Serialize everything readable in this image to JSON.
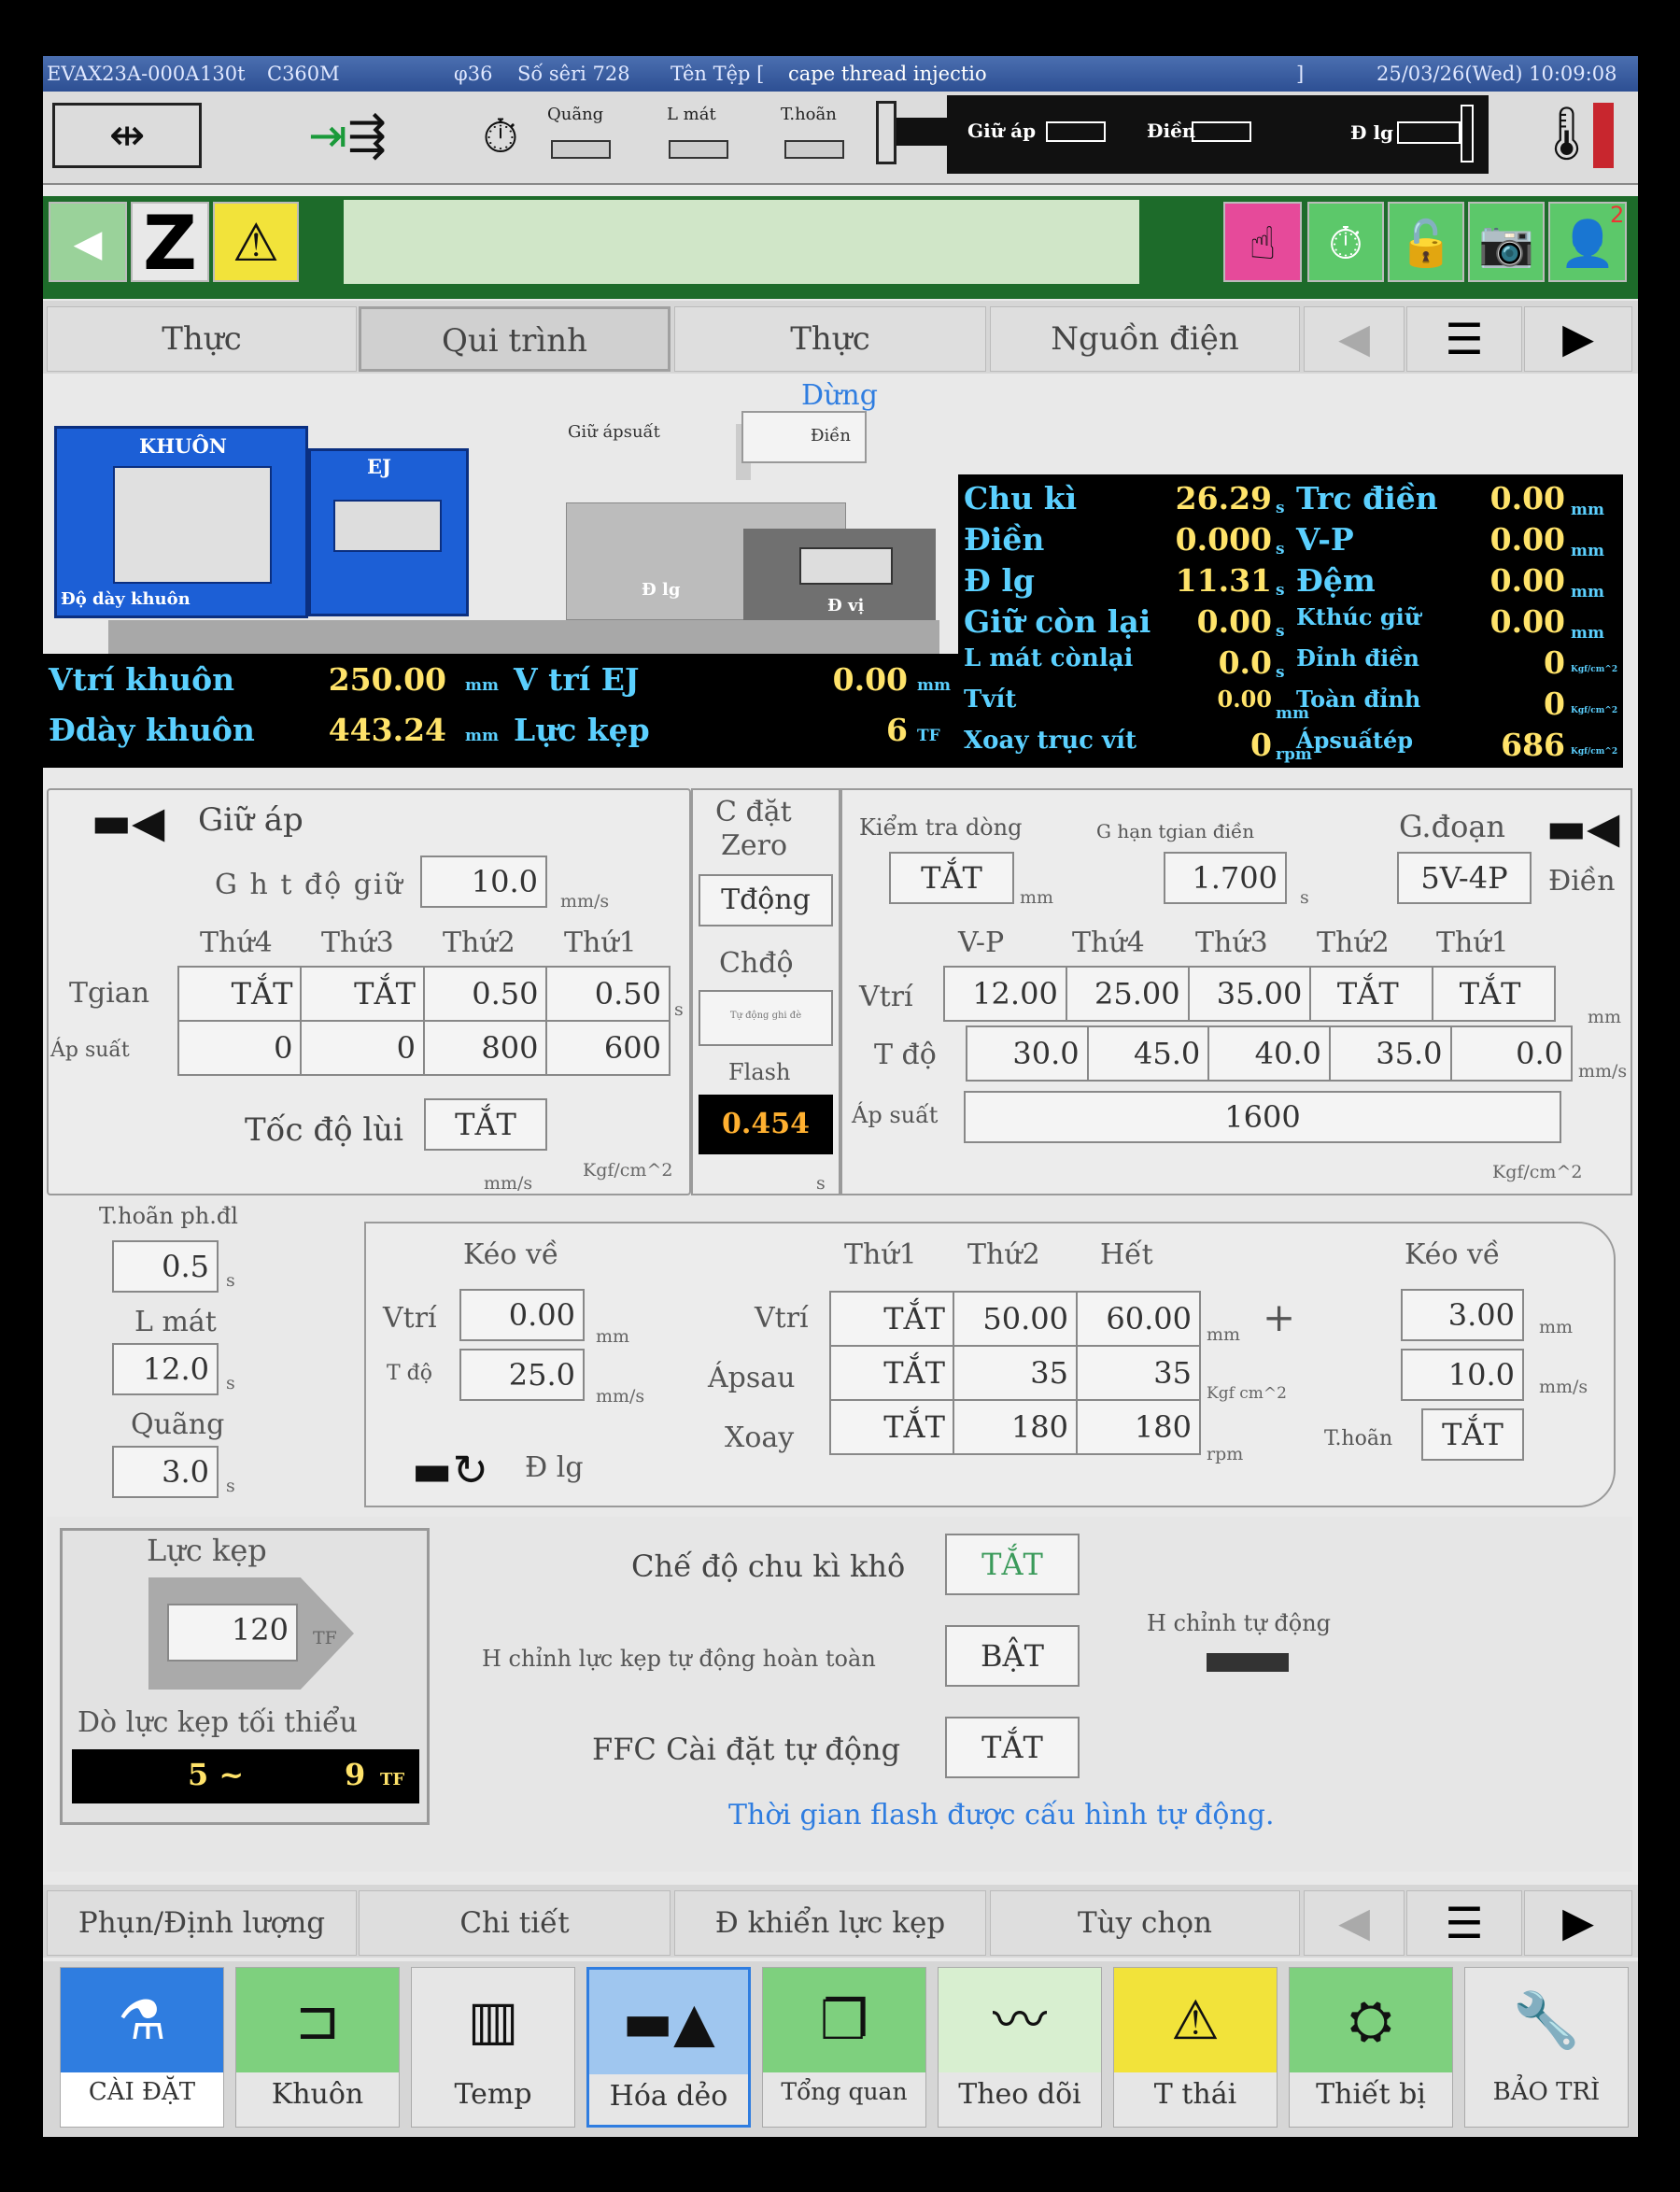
{
  "header": {
    "model": "EVAX23A-000A",
    "tonnage": "130t",
    "controller": "C360M",
    "screw": "φ36",
    "serial": "Số sêri 728",
    "file_label": "Tên Tệp [",
    "file_name": "cape thread injectio",
    "file_end": "]",
    "datetime": "25/03/26(Wed) 10:09:08"
  },
  "status": {
    "quang": "Quãng",
    "lmat": "L mát",
    "thoan": "T.hoãn",
    "giu_ap": "Giữ áp",
    "dien": "Điền",
    "dlg": "Đ lg"
  },
  "toolbar": {
    "user_count": "2"
  },
  "tabs_top": [
    "Thực",
    "Qui trình",
    "Thực",
    "Nguồn điện"
  ],
  "machine": {
    "state": "Dừng",
    "mold": "KHUÔN",
    "ej": "EJ",
    "mold_thick": "Độ dày khuôn",
    "hold_label": "Giữ ápsuất",
    "fill_label": "Điền",
    "dlg": "Đ lg",
    "dvi": "Đ vị",
    "vtri_khuon": {
      "label": "Vtrí khuôn",
      "value": "250.00",
      "unit": "mm"
    },
    "vtri_ej": {
      "label": "V trí EJ",
      "value": "0.00",
      "unit": "mm"
    },
    "day_khuon": {
      "label": "Đdày khuôn",
      "value": "443.24",
      "unit": "mm"
    },
    "luc_kep": {
      "label": "Lực kẹp",
      "value": "6",
      "unit": "TF"
    }
  },
  "monitor": [
    {
      "k": "Chu kì",
      "v": "26.29",
      "u": "s",
      "k2": "Trc điền",
      "v2": "0.00",
      "u2": "mm"
    },
    {
      "k": "Điền",
      "v": "0.000",
      "u": "s",
      "k2": "V-P",
      "v2": "0.00",
      "u2": "mm"
    },
    {
      "k": "Đ lg",
      "v": "11.31",
      "u": "s",
      "k2": "Đệm",
      "v2": "0.00",
      "u2": "mm"
    },
    {
      "k": "Giữ còn lại",
      "v": "0.00",
      "u": "s",
      "k2": "Kthúc giữ",
      "v2": "0.00",
      "u2": "mm"
    },
    {
      "k": "L mát cònlại",
      "v": "0.0",
      "u": "s",
      "k2": "Đỉnh điền",
      "v2": "0",
      "u2": "Kgf/cm^2"
    },
    {
      "k": "Tvít",
      "v": "0.00",
      "u": "mm",
      "k2": "Toàn đỉnh",
      "v2": "0",
      "u2": "Kgf/cm^2"
    },
    {
      "k": "Xoay trục vít",
      "v": "0",
      "u": "rpm",
      "k2": "Ápsuấtép",
      "v2": "686",
      "u2": "Kgf/cm^2"
    }
  ],
  "hold": {
    "title": "Giữ áp",
    "speed_label": "G h t độ giữ",
    "speed_value": "10.0",
    "speed_unit": "mm/s",
    "headers": [
      "Thứ4",
      "Thứ3",
      "Thứ2",
      "Thứ1"
    ],
    "row_time_label": "Tgian",
    "row_time": [
      "TẮT",
      "TẮT",
      "0.50",
      "0.50"
    ],
    "time_unit": "s",
    "row_press_label": "Áp suất",
    "row_press": [
      "0",
      "0",
      "800",
      "600"
    ],
    "press_unit": "Kgf/cm^2",
    "retract_label": "Tốc độ lùi",
    "retract_value": "TẮT",
    "retract_unit": "mm/s"
  },
  "zero": {
    "title1": "C đặt",
    "title2": "Zero",
    "mode_btn": "Tđộng",
    "chedo": "Chđộ",
    "chedo_small": "Tự động ghi đè",
    "flash_label": "Flash",
    "flash_value": "0.454",
    "flash_unit": "s"
  },
  "fill": {
    "check_label": "Kiểm tra dòng",
    "check_value": "TẮT",
    "check_unit": "mm",
    "limit_label": "G hạn tgian điền",
    "limit_value": "1.700",
    "limit_unit": "s",
    "stage_label": "G.đoạn",
    "stage_value": "5V-4P",
    "fill_label": "Điền",
    "headers": [
      "V-P",
      "Thứ4",
      "Thứ3",
      "Thứ2",
      "Thứ1"
    ],
    "pos_label": "Vtrí",
    "pos": [
      "12.00",
      "25.00",
      "35.00",
      "TẮT",
      "TẮT"
    ],
    "pos_unit": "mm",
    "spd_label": "T độ",
    "spd": [
      "30.0",
      "45.0",
      "40.0",
      "35.0",
      "0.0"
    ],
    "spd_unit": "mm/s",
    "press_label": "Áp suất",
    "press": "1600",
    "press_unit": "Kgf/cm^2"
  },
  "timers": {
    "delay_label": "T.hoãn ph.đl",
    "delay": "0.5",
    "cool_label": "L mát",
    "cool": "12.0",
    "interval_label": "Quãng",
    "interval": "3.0",
    "unit": "s"
  },
  "plast": {
    "pull1": "Kéo về",
    "pos_label": "Vtrí",
    "pos": "0.00",
    "pos_unit": "mm",
    "spd_label": "T độ",
    "spd": "25.0",
    "spd_unit": "mm/s",
    "headers": [
      "Thứ1",
      "Thứ2",
      "Hết"
    ],
    "r_pos_label": "Vtrí",
    "r_pos": [
      "TẮT",
      "50.00",
      "60.00"
    ],
    "r_pos_unit": "mm",
    "r_back_label": "Ápsau",
    "r_back": [
      "TẮT",
      "35",
      "35"
    ],
    "r_back_unit": "Kgf cm^2",
    "r_rot_label": "Xoay",
    "r_rot": [
      "TẮT",
      "180",
      "180"
    ],
    "r_rot_unit": "rpm",
    "plus": "+",
    "pull2": "Kéo về",
    "pull2_pos": "3.00",
    "pull2_pos_unit": "mm",
    "pull2_spd": "10.0",
    "pull2_spd_unit": "mm/s",
    "delay_label": "T.hoãn",
    "delay": "TẮT",
    "dlg": "Đ lg"
  },
  "clamp": {
    "title": "Lực kẹp",
    "value": "120",
    "unit": "TF",
    "min_label": "Dò lực kẹp tối thiểu",
    "min_from": "5 ~",
    "min_to": "9",
    "min_unit": "TF",
    "dry_label": "Chế độ chu kì khô",
    "dry": "TẮT",
    "auto_label": "H chỉnh lực kẹp tự động hoàn toàn",
    "auto": "BẬT",
    "ffc_label": "FFC Cài đặt tự động",
    "ffc": "TẮT",
    "auto_adj": "H chỉnh tự động",
    "note": "Thời gian flash được cấu hình tự động."
  },
  "tabs_bottom": [
    "Phụn/Định lượng",
    "Chi tiết",
    "Đ khiển lực kẹp",
    "Tùy chọn"
  ],
  "nav": [
    "CÀI ĐẶT",
    "Khuôn",
    "Temp",
    "Hóa dẻo",
    "Tổng quan",
    "Theo dõi",
    "T thái",
    "Thiết bị",
    "BẢO TRÌ"
  ],
  "colors": {
    "header": "#2d4f93",
    "green_bar": "#1d6b2a",
    "monitor_key": "#5bd0ff",
    "monitor_value": "#ffe36a",
    "accent_blue": "#2f7de0"
  }
}
